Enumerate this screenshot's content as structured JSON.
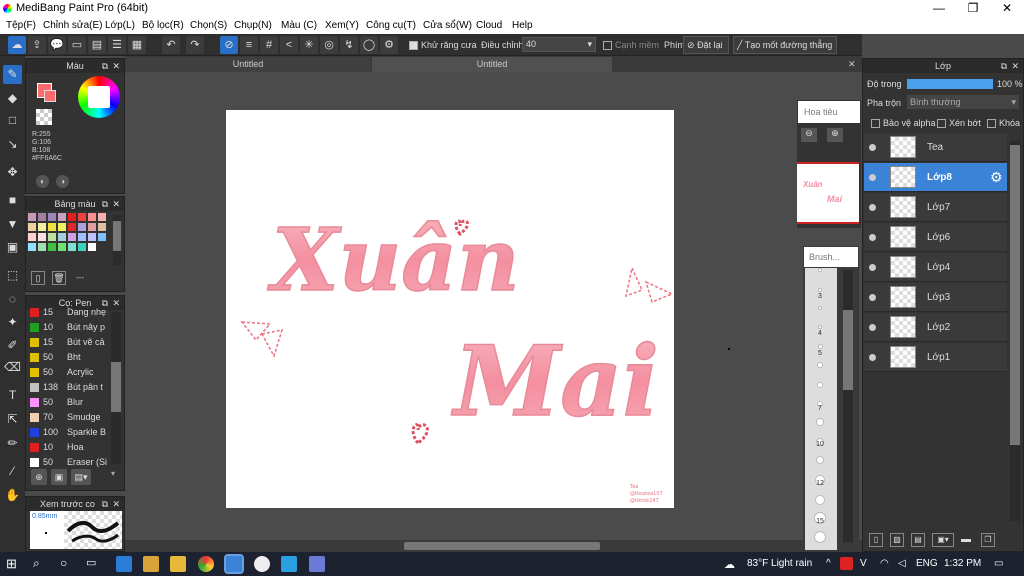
{
  "app": {
    "title": "MediBang Paint Pro (64bit)"
  },
  "menu": [
    "Tệp(F)",
    "Chỉnh sửa(E)",
    "Lớp(L)",
    "Bộ lọc(R)",
    "Chọn(S)",
    "Chụp(N)",
    "Màu (C)",
    "Xem(Y)",
    "Công cụ(T)",
    "Cửa sổ(W)",
    "Cloud",
    "Help"
  ],
  "toolbar": {
    "antialias_label": "Khử răng cưa",
    "adjust_label": "Điều chỉnh",
    "adjust_value": "40",
    "margin_label": "Cạnh mềm",
    "key_label": "Phím",
    "reset_label": "Đặt lại",
    "ruler_label": "Tạo mốt đường thẳng"
  },
  "tabs": [
    "Untitled",
    "Untitled"
  ],
  "color_panel": {
    "title": "Màu",
    "r": "R:255",
    "g": "G:106",
    "b": "B:108",
    "hex": "#FF6A6C",
    "primary_color": "#ff6a6c"
  },
  "palette_panel": {
    "title": "Bảng màu",
    "colors": [
      "#c79ab7",
      "#a07fa0",
      "#9a86b7",
      "#c8a0c0",
      "#e02020",
      "#f04040",
      "#ff9090",
      "#f7b0b0",
      "#f0d0a0",
      "#f0f0a0",
      "#f0e040",
      "#f0f060",
      "#e02828",
      "#b0a0e0",
      "#e0a0a0",
      "#e0c0a0",
      "#ffd0d0",
      "#ffe0e0",
      "#c0e0a0",
      "#a0d0e0",
      "#d0a0e0",
      "#a0c0ff",
      "#c0c0ff",
      "#80c0ff",
      "#90e0ff",
      "#a0e0b0",
      "#40c040",
      "#70e070",
      "#80e0d0",
      "#40d0c0",
      "#ffffff"
    ],
    "dash": "---"
  },
  "brush_panel": {
    "title": "Cọ: Pen",
    "brushes": [
      {
        "size": "15",
        "name": "Dang nhẹ",
        "color": "#e02020"
      },
      {
        "size": "10",
        "name": "Bút nây p",
        "color": "#20a020"
      },
      {
        "size": "15",
        "name": "Bút vẽ cả",
        "color": "#e0c000"
      },
      {
        "size": "50",
        "name": "Bht",
        "color": "#e0c000"
      },
      {
        "size": "50",
        "name": "Acrylic",
        "color": "#e0c000"
      },
      {
        "size": "138",
        "name": "Bút pân t",
        "color": "#c0c0c0"
      },
      {
        "size": "50",
        "name": "Blur",
        "color": "#ff90ff"
      },
      {
        "size": "70",
        "name": "Smudge",
        "color": "#f0d0b0"
      },
      {
        "size": "100",
        "name": "Sparkle B",
        "color": "#2040e0"
      },
      {
        "size": "10",
        "name": "Hoa",
        "color": "#e02020"
      },
      {
        "size": "50",
        "name": "Eraser (Si",
        "color": "#ffffff"
      }
    ]
  },
  "preview_panel": {
    "title": "Xem trước co",
    "size": "0.85mm"
  },
  "navigator": {
    "title": "Hoa tiêu"
  },
  "brush_size_panel": {
    "title": "Brush...",
    "sizes": [
      "3",
      "4",
      "5",
      "7",
      "10",
      "12",
      "15"
    ]
  },
  "layer_panel": {
    "title": "Lớp",
    "opacity_label": "Độ trong",
    "opacity_value": "100 %",
    "opacity": 1.0,
    "blend_label": "Pha trộn",
    "blend_value": "Bình thường",
    "protect_alpha": "Bảo vệ alpha",
    "clip": "Xén bớt",
    "lock": "Khóa",
    "layers": [
      "Tea",
      "Lớp8",
      "Lớp7",
      "Lớp6",
      "Lớp4",
      "Lớp3",
      "Lớp2",
      "Lớp1"
    ],
    "selected": "Lớp8"
  },
  "artwork": {
    "line1": "Xuân",
    "line2": "Mai",
    "signature1": "Tea",
    "signature2": "@tteatea107",
    "signature3": "@tiktok247"
  },
  "taskbar": {
    "weather": "83°F  Light rain",
    "lang": "ENG",
    "time": "1:32 PM"
  }
}
